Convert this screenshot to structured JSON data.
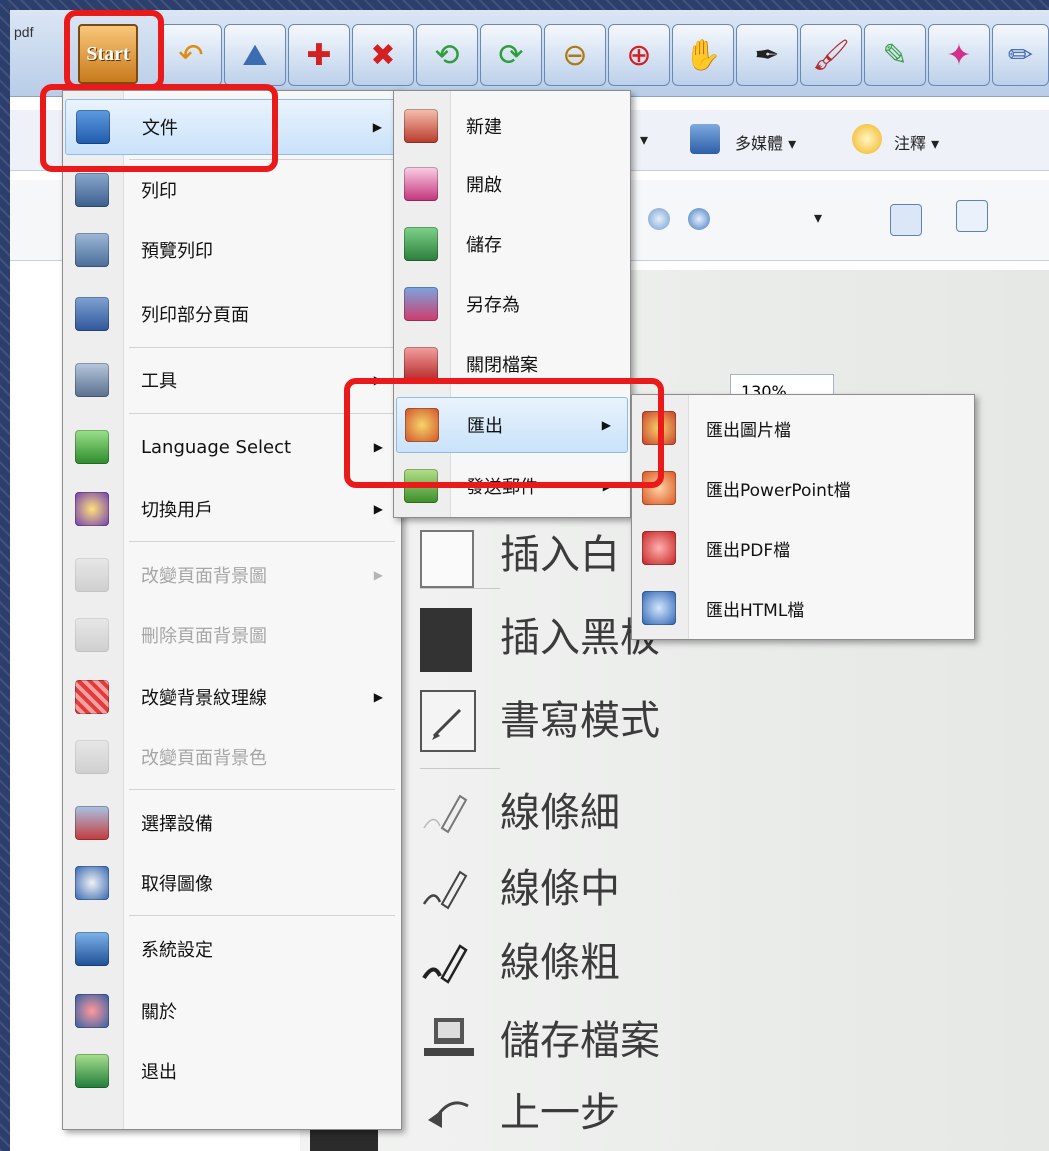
{
  "toolbar": {
    "doc_label": "pdf",
    "start_label": "Start",
    "buttons": [
      "undo-redo-icon",
      "image-icon",
      "add-page-icon",
      "delete-page-icon",
      "prev-page-icon",
      "next-page-icon",
      "zoom-out-icon",
      "zoom-in-icon",
      "hand-icon",
      "pen-icon",
      "brush-icon",
      "highlighter-icon",
      "pencil-icon"
    ]
  },
  "ribbon": {
    "multimedia_label": "多媒體",
    "annotation_label": "注釋",
    "zoom_value": "130%"
  },
  "start_menu": {
    "items": [
      {
        "label": "文件",
        "submenu": true,
        "highlighted": true
      },
      {
        "label": "列印"
      },
      {
        "label": "預覽列印"
      },
      {
        "label": "列印部分頁面"
      },
      {
        "label": "工具",
        "submenu": true
      },
      {
        "label": "Language Select",
        "submenu": true
      },
      {
        "label": "切換用戶",
        "submenu": true
      },
      {
        "label": "改變頁面背景圖",
        "submenu": true,
        "disabled": true
      },
      {
        "label": "刪除頁面背景圖",
        "disabled": true
      },
      {
        "label": "改變背景紋理線",
        "submenu": true
      },
      {
        "label": "改變頁面背景色",
        "disabled": true
      },
      {
        "label": "選擇設備"
      },
      {
        "label": "取得圖像"
      },
      {
        "label": "系統設定"
      },
      {
        "label": "關於"
      },
      {
        "label": "退出"
      }
    ]
  },
  "file_menu": {
    "items": [
      {
        "label": "新建"
      },
      {
        "label": "開啟"
      },
      {
        "label": "儲存"
      },
      {
        "label": "另存為"
      },
      {
        "label": "關閉檔案"
      },
      {
        "label": "匯出",
        "submenu": true,
        "highlighted": true
      },
      {
        "label": "發送郵件",
        "submenu": true
      }
    ]
  },
  "export_menu": {
    "items": [
      {
        "label": "匯出圖片檔"
      },
      {
        "label": "匯出PowerPoint檔"
      },
      {
        "label": "匯出PDF檔"
      },
      {
        "label": "匯出HTML檔"
      }
    ]
  },
  "background_list": {
    "items": [
      "插入白",
      "插入黑板",
      "書寫模式",
      "線條細",
      "線條中",
      "線條粗",
      "儲存檔案",
      "上一步"
    ]
  },
  "colors": {
    "highlight_box": "#ea1a1a",
    "menu_highlight": "#c9e2fa",
    "frame": "#2c3e6c"
  }
}
